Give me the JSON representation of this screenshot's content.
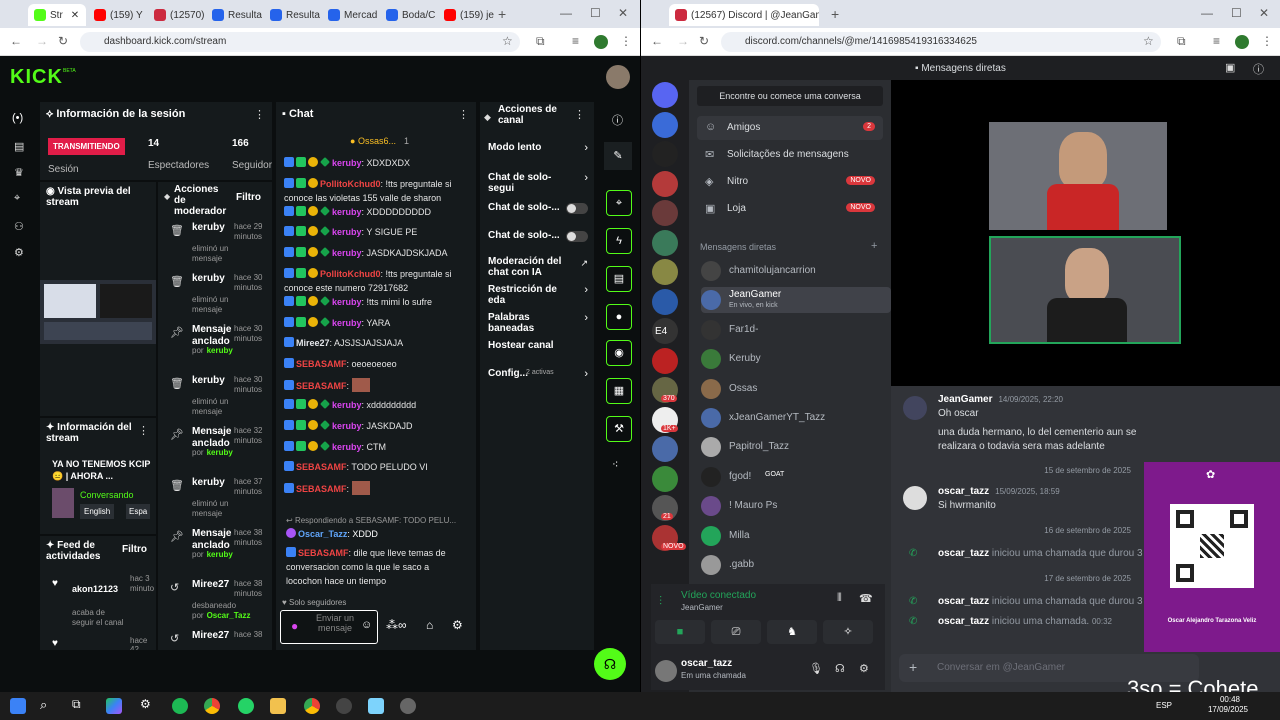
{
  "left_browser": {
    "tabs": [
      "Str",
      "(159) Y",
      "(12570)",
      "Resulta",
      "Resulta",
      "Mercad",
      "Boda/C",
      "(159) je"
    ],
    "url": "dashboard.kick.com/stream"
  },
  "kick": {
    "logo": "KICK",
    "logo_super": "BETA",
    "session": {
      "title": "Información de la sesión",
      "live_badge": "TRANSMITIENDO",
      "live_sub": "Sesión",
      "viewers_num": "14",
      "viewers_label": "Espectadores",
      "followers_num": "166",
      "followers_label": "Seguidor"
    },
    "preview": {
      "title": "Vista previa del stream"
    },
    "stream_info": {
      "title": "Información del stream",
      "stream_title": "YA NO TENEMOS KCIP 😑 | AHORA ...",
      "category": "Conversando",
      "tags": [
        "English",
        "Espa"
      ]
    },
    "activity": {
      "title": "Feed de actividades",
      "filter": "Filtro",
      "items": [
        {
          "user": "akon12123",
          "time": "hac 3 minuto",
          "desc": "acaba de seguir el canal"
        },
        {
          "user": "",
          "time": "hace 42",
          "desc": ""
        }
      ]
    },
    "mod": {
      "title": "Acciones de moderador",
      "filter": "Filtro",
      "rows": [
        {
          "icon": "trash",
          "name": "keruby",
          "time": "hace 29 minutos",
          "desc": "eliminó un mensaje",
          "by": ""
        },
        {
          "icon": "trash",
          "name": "keruby",
          "time": "hace 30 minutos",
          "desc": "eliminó un mensaje",
          "by": ""
        },
        {
          "icon": "pin",
          "name": "Mensaje anclado",
          "time": "hace 30 minutos",
          "desc": "por",
          "by": "keruby"
        },
        {
          "icon": "trash",
          "name": "keruby",
          "time": "hace 30 minutos",
          "desc": "eliminó un mensaje",
          "by": ""
        },
        {
          "icon": "pin",
          "name": "Mensaje anclado",
          "time": "hace 32 minutos",
          "desc": "por",
          "by": "keruby"
        },
        {
          "icon": "trash",
          "name": "keruby",
          "time": "hace 37 minutos",
          "desc": "eliminó un mensaje",
          "by": ""
        },
        {
          "icon": "pin",
          "name": "Mensaje anclado",
          "time": "hace 38 minutos",
          "desc": "por",
          "by": "keruby"
        },
        {
          "icon": "ban",
          "name": "Miree27",
          "time": "hace 38 minutos",
          "desc": "desbaneado por",
          "by": "Oscar_Tazz"
        },
        {
          "icon": "ban",
          "name": "Miree27",
          "time": "hace 38",
          "desc": "",
          "by": ""
        }
      ]
    },
    "chat": {
      "title": "Chat",
      "pinned": "Ossas6...",
      "pinned_count": "1",
      "messages": [
        {
          "user": "keruby",
          "color": "#d946ef",
          "text": "XDXDXDX",
          "badges": 4
        },
        {
          "user": "PollitoKchud0",
          "color": "#ef4444",
          "text": "!tts preguntale si conoce las violetas 155 valle de sharon",
          "badges": 3
        },
        {
          "user": "keruby",
          "color": "#d946ef",
          "text": "XDDDDDDDDD",
          "badges": 4
        },
        {
          "user": "keruby",
          "color": "#d946ef",
          "text": "Y SIGUE PE",
          "badges": 4
        },
        {
          "user": "keruby",
          "color": "#d946ef",
          "text": "JASDKAJDSKJADA",
          "badges": 4
        },
        {
          "user": "PollitoKchud0",
          "color": "#ef4444",
          "text": "!tts preguntale si conoce este numero 72917682",
          "badges": 3
        },
        {
          "user": "keruby",
          "color": "#d946ef",
          "text": "!tts mimi lo sufre",
          "badges": 4
        },
        {
          "user": "keruby",
          "color": "#d946ef",
          "text": "YARA",
          "badges": 4
        },
        {
          "user": "Miree27",
          "color": "#e5e7eb",
          "text": "AJSJSJAJSJAJA",
          "badges": 1
        },
        {
          "user": "SEBASAMF",
          "color": "#ef4444",
          "text": "oeoeoeoeo",
          "badges": 1
        },
        {
          "user": "SEBASAMF",
          "color": "#ef4444",
          "text": "",
          "badges": 1
        },
        {
          "user": "keruby",
          "color": "#d946ef",
          "text": "xddddddddd",
          "badges": 4
        },
        {
          "user": "keruby",
          "color": "#d946ef",
          "text": "JASKDAJD",
          "badges": 4
        },
        {
          "user": "keruby",
          "color": "#d946ef",
          "text": "CTM",
          "badges": 4
        },
        {
          "user": "SEBASAMF",
          "color": "#ef4444",
          "text": "TODO PELUDO VI",
          "badges": 1
        },
        {
          "user": "SEBASAMF",
          "color": "#ef4444",
          "text": "",
          "badges": 1
        }
      ],
      "reply_to": "Respondiendo a SEBASAMF: TODO PELU...",
      "reply_user": "Oscar_Tazz",
      "reply_text": "XDDD",
      "last_user": "SEBASAMF",
      "last_text": "dile que lleve temas de conversacion como la que le saco a locochon hace un tiempo",
      "followers_only": "Solo seguidores",
      "input_placeholder": "Enviar un mensaje"
    },
    "channel_actions": {
      "title": "Acciones de canal",
      "items": [
        {
          "label": "Modo lento",
          "type": "chev"
        },
        {
          "label": "Chat de solo-segui",
          "type": "chev"
        },
        {
          "label": "Chat de solo-...",
          "type": "toggle"
        },
        {
          "label": "Chat de solo-...",
          "type": "toggle"
        },
        {
          "label": "Moderación del chat con IA",
          "type": "ext"
        },
        {
          "label": "Restricción de eda",
          "type": "chev"
        },
        {
          "label": "Palabras baneadas",
          "type": "chev"
        },
        {
          "label": "Hostear canal",
          "type": "none"
        },
        {
          "label": "Config...",
          "type": "chev"
        }
      ],
      "config_badge": "2 activas"
    }
  },
  "right_browser": {
    "tab": "(12567) Discord | @JeanGam",
    "url": "discord.com/channels/@me/1416985419316334625"
  },
  "discord": {
    "header": "Mensagens diretas",
    "search": "Encontre ou comece uma conversa",
    "nav": [
      {
        "label": "Amigos",
        "badge": "2"
      },
      {
        "label": "Solicitações de mensagens",
        "badge": ""
      },
      {
        "label": "Nitro",
        "badge": "NOVO"
      },
      {
        "label": "Loja",
        "badge": "NOVO"
      }
    ],
    "dm_header": "Mensagens diretas",
    "dms": [
      {
        "name": "chamitolujancarrion",
        "sub": ""
      },
      {
        "name": "JeanGamer",
        "sub": "En vivo, en kick"
      },
      {
        "name": "Far1d-",
        "sub": ""
      },
      {
        "name": "Keruby",
        "sub": ""
      },
      {
        "name": "Ossas",
        "sub": ""
      },
      {
        "name": "xJeanGamerYT_Tazz",
        "sub": ""
      },
      {
        "name": "Papitrol_Tazz",
        "sub": ""
      },
      {
        "name": "fgod!",
        "sub": "GOAT"
      },
      {
        "name": "! Mauro Ps",
        "sub": ""
      },
      {
        "name": "Milla",
        "sub": ""
      },
      {
        "name": ".gabb",
        "sub": ""
      }
    ],
    "guild_labels": [
      "E4",
      "370",
      "1K+",
      "21",
      "NOVO"
    ],
    "voice": {
      "status": "Vídeo conectado",
      "channel": "JeanGamer"
    },
    "user": {
      "name": "oscar_tazz",
      "status": "Em uma chamada"
    },
    "messages": [
      {
        "user": "JeanGamer",
        "time": "14/09/2025, 22:20",
        "lines": [
          "Oh oscar",
          "una duda hermano, lo del cementerio aun se realizara o todavia sera mas adelante"
        ]
      },
      {
        "user": "oscar_tazz",
        "time": "15/09/2025, 18:59",
        "lines": [
          "Si hwrmanito"
        ]
      }
    ],
    "separators": [
      "15 de setembro de 2025",
      "16 de setembro de 2025",
      "17 de setembro de 2025"
    ],
    "calls": [
      {
        "user": "oscar_tazz",
        "text": "iniciou uma chamada que durou 3"
      },
      {
        "user": "oscar_tazz",
        "text": "iniciou uma chamada que durou 3"
      },
      {
        "user": "oscar_tazz",
        "text": "iniciou uma chamada.",
        "dur": "00:32"
      }
    ],
    "composer": "Conversar em @JeanGamer",
    "qr_name": "Oscar Alejandro Tarazona Veliz"
  },
  "overlay_text": "3so = Cohete",
  "taskbar": {
    "lang": "ESP",
    "time": "00:48",
    "date": "17/09/2025"
  }
}
